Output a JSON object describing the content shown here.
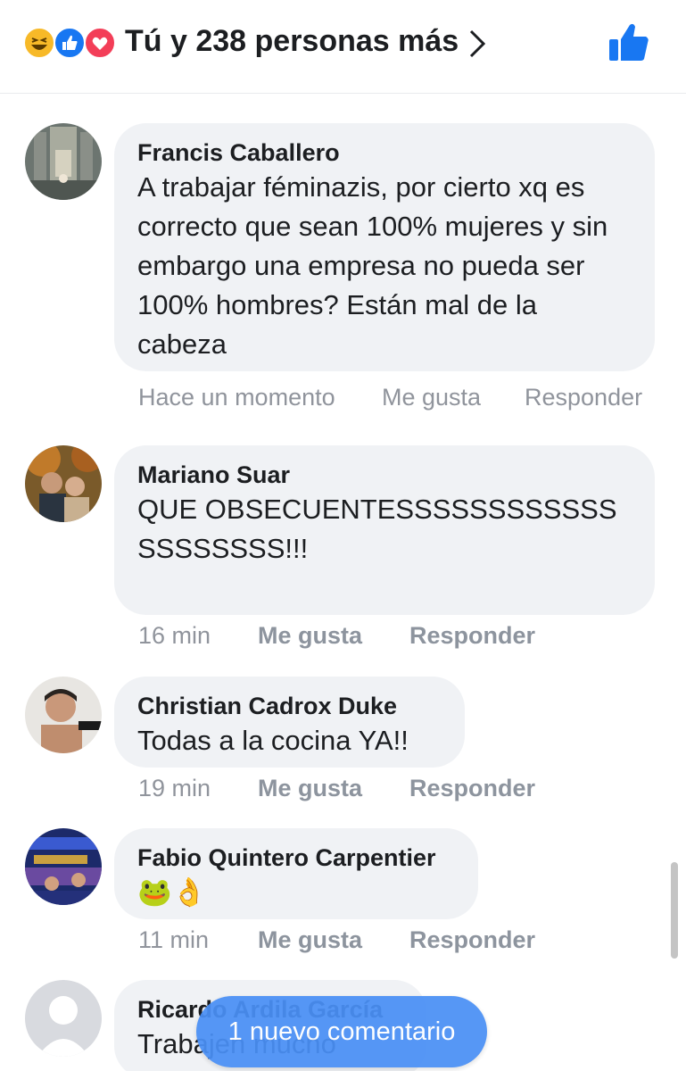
{
  "header": {
    "reactions_text": "Tú y 238 personas más",
    "reaction_icons": [
      "haha-icon",
      "like-icon",
      "love-icon"
    ],
    "like_button_icon": "thumbs-up-icon"
  },
  "comments": [
    {
      "author": "Francis Caballero",
      "text": "A trabajar féminazis, por cierto xq es correcto que sean 100% mujeres y sin embargo una empresa no pueda ser 100% hombres? Están mal de la cabeza",
      "time": "Hace un momento",
      "like_label": "Me gusta",
      "reply_label": "Responder"
    },
    {
      "author": "Mariano Suar",
      "text": "QUE OBSECUENTESSSSSSSSSSSSSSSSSSSS!!!",
      "time": "16 min",
      "like_label": "Me gusta",
      "reply_label": "Responder"
    },
    {
      "author": "Christian Cadrox Duke",
      "text": "Todas a la cocina YA!!",
      "time": "19 min",
      "like_label": "Me gusta",
      "reply_label": "Responder"
    },
    {
      "author": "Fabio Quintero Carpentier",
      "text": "🐸👌",
      "time": "11 min",
      "like_label": "Me gusta",
      "reply_label": "Responder"
    },
    {
      "author": "Ricardo Ardila García",
      "text": "Trabajen mucho",
      "time": "",
      "like_label": "",
      "reply_label": ""
    }
  ],
  "new_comment_pill": "1 nuevo comentario",
  "colors": {
    "accent": "#1877f2",
    "bubble": "#f0f2f5",
    "meta": "#90949c"
  }
}
